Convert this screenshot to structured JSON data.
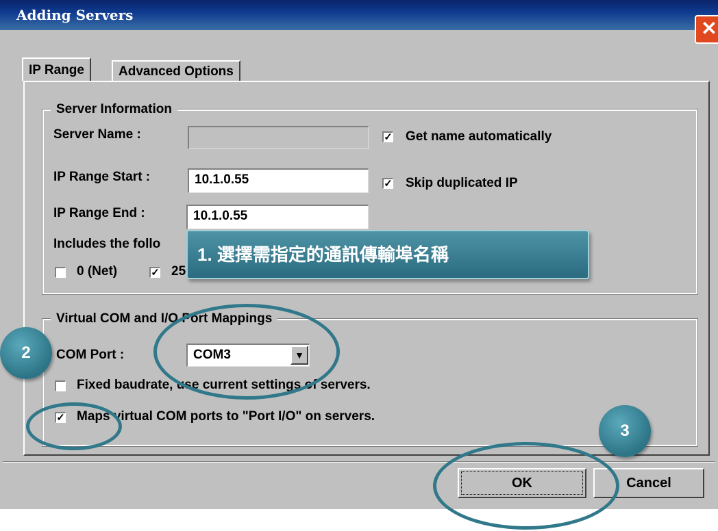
{
  "window": {
    "title": "Adding Servers",
    "close_glyph": "✕"
  },
  "tabs": [
    {
      "label": "IP Range"
    },
    {
      "label": "Advanced Options"
    }
  ],
  "server_info": {
    "group_label": "Server Information",
    "server_name_label": "Server Name :",
    "server_name_value": "",
    "get_name_auto": {
      "label": "Get name automatically",
      "checked": true
    },
    "ip_start_label": "IP Range Start :",
    "ip_start_value": "10.1.0.55",
    "skip_dup": {
      "label": "Skip duplicated IP",
      "checked": true
    },
    "ip_end_label": "IP Range End :",
    "ip_end_value": "10.1.0.55",
    "includes_label": "Includes the follo",
    "port_net": {
      "label": "0 (Net)",
      "checked": false
    },
    "port_25": {
      "label": "25",
      "checked": true
    }
  },
  "mappings": {
    "group_label": "Virtual COM and I/O Port Mappings",
    "com_port_label": "COM Port :",
    "com_port_value": "COM3",
    "fixed_baud": {
      "label": "Fixed baudrate, use current settings of servers.",
      "checked": false
    },
    "maps_virtual": {
      "label": "Maps virtual COM ports to \"Port I/O\" on servers.",
      "checked": true
    }
  },
  "buttons": {
    "ok": "OK",
    "cancel": "Cancel"
  },
  "annotations": {
    "callout_1": "1. 選擇需指定的通訊傳輸埠名稱",
    "badge_2": "2",
    "badge_3": "3"
  },
  "colors": {
    "annotation_teal": "#31788a",
    "titlebar": "#0a246a",
    "dialog_bg": "#c0c0c0"
  }
}
